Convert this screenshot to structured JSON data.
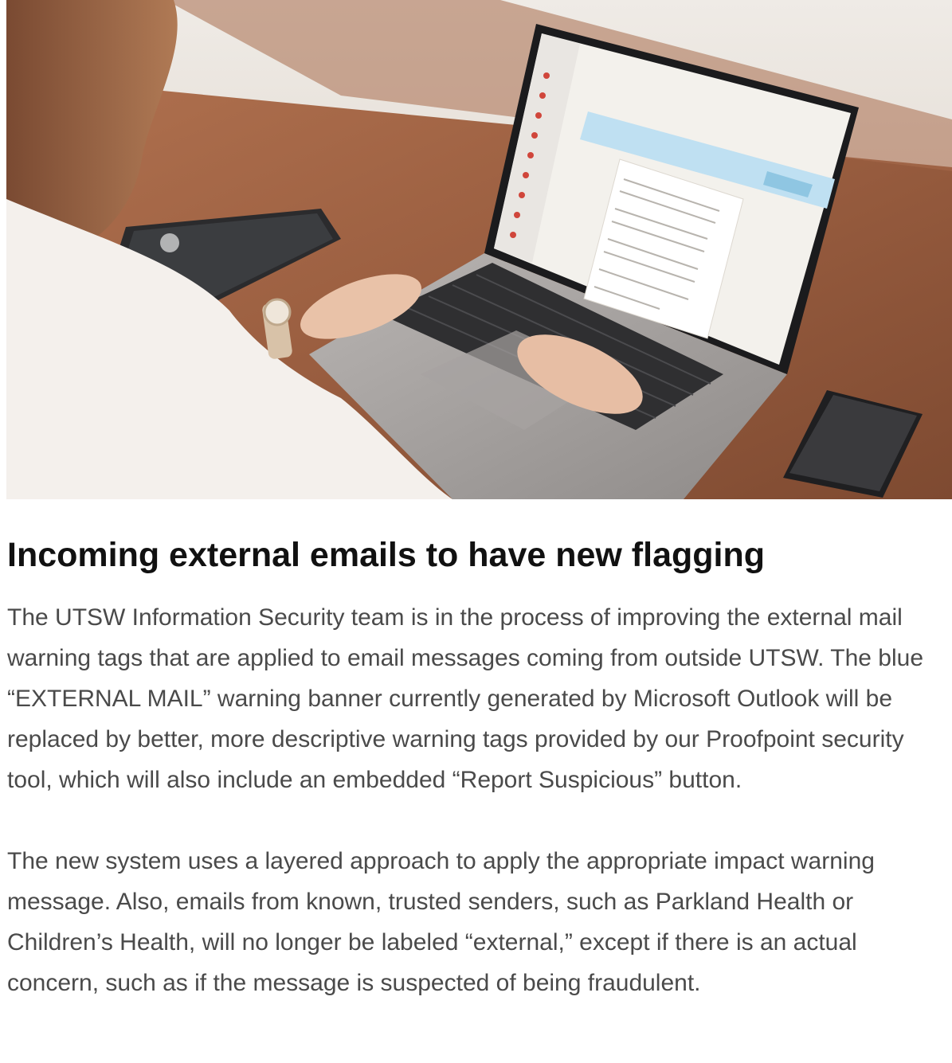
{
  "hero": {
    "icon": "photo-woman-laptop-email"
  },
  "article": {
    "title": "Incoming external emails to have new flagging",
    "paragraphs": [
      "The UTSW Information Security team is in the process of improving the external mail warning tags that are applied to email messages coming from outside UTSW. The blue “EXTERNAL MAIL” warning banner currently generated by Microsoft Outlook will be replaced by better, more descriptive warning tags provided by our Proofpoint security tool, which will also include an embedded “Report Suspicious” button.",
      "The new system uses a layered approach to apply the appropriate impact warning message. Also, emails from known, trusted senders, such as Parkland Health or Children’s Health, will no longer be labeled “external,” except if there is an actual concern, such as if the message is suspected of being fraudulent."
    ]
  },
  "colors": {
    "title": "#111111",
    "body_text": "#4a4a4a",
    "table_wood": "#9a5e40",
    "external_banner_blue": "#bfe0f2",
    "report_button": "#8fc6e2"
  }
}
